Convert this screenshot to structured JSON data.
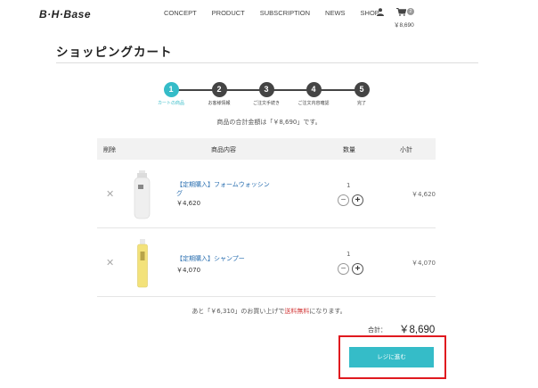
{
  "header": {
    "logo": "B·H·Base",
    "nav": [
      "CONCEPT",
      "PRODUCT",
      "SUBSCRIPTION",
      "NEWS",
      "SHOP"
    ],
    "cart_badge": "2",
    "cart_total": "￥8,690"
  },
  "page": {
    "title": "ショッピングカート",
    "subtotal_message": "商品の合計金額は「￥8,690」です。"
  },
  "steps": [
    {
      "number": "1",
      "label": "カートの商品",
      "active": true
    },
    {
      "number": "2",
      "label": "お客様情報",
      "active": false
    },
    {
      "number": "3",
      "label": "ご注文手続き",
      "active": false
    },
    {
      "number": "4",
      "label": "ご注文内容確認",
      "active": false
    },
    {
      "number": "5",
      "label": "完了",
      "active": false
    }
  ],
  "table": {
    "headers": {
      "delete": "削除",
      "product": "商品内容",
      "quantity": "数量",
      "subtotal": "小計"
    },
    "rows": [
      {
        "name": "【定期購入】フォームウォッシング",
        "price": "￥4,620",
        "quantity": "1",
        "subtotal": "￥4,620",
        "image": "foam-bottle-image"
      },
      {
        "name": "【定期購入】シャンプー",
        "price": "￥4,070",
        "quantity": "1",
        "subtotal": "￥4,070",
        "image": "shampoo-bottle-image"
      }
    ]
  },
  "shipping": {
    "prefix": "あと「￥6,310」のお買い上げで",
    "highlight": "送料無料",
    "suffix": "になります。"
  },
  "total": {
    "label": "合計：",
    "value": "￥8,690"
  },
  "checkout": {
    "label": "レジに進む"
  },
  "colors": {
    "accent": "#35bcc8",
    "dark": "#444444",
    "highlight_frame": "#e0191f",
    "link": "#2a6fb0",
    "free_shipping": "#d23a3a"
  }
}
